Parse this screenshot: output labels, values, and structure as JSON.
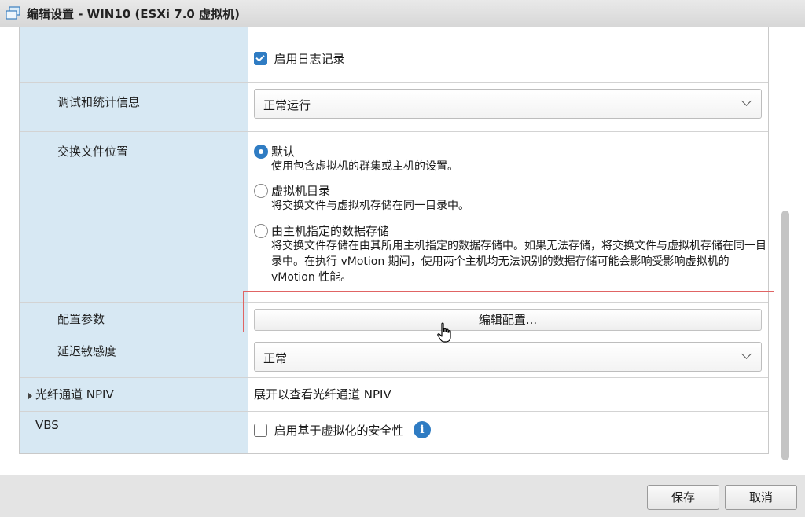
{
  "window": {
    "title": "编辑设置 - WIN10 (ESXi 7.0 虚拟机)"
  },
  "logging": {
    "checkbox_label": "启用日志记录",
    "checked": true
  },
  "debug_stats": {
    "label": "调试和统计信息",
    "value": "正常运行"
  },
  "swap_location": {
    "label": "交换文件位置",
    "options": [
      {
        "title": "默认",
        "desc": "使用包含虚拟机的群集或主机的设置。",
        "selected": true
      },
      {
        "title": "虚拟机目录",
        "desc": "将交换文件与虚拟机存储在同一目录中。",
        "selected": false
      },
      {
        "title": "由主机指定的数据存储",
        "desc": "将交换文件存储在由其所用主机指定的数据存储中。如果无法存储，将交换文件与虚拟机存储在同一目录中。在执行 vMotion 期间，使用两个主机均无法识别的数据存储可能会影响受影响虚拟机的 vMotion 性能。",
        "selected": false
      }
    ]
  },
  "config_params": {
    "label": "配置参数",
    "button_label": "编辑配置..."
  },
  "latency": {
    "label": "延迟敏感度",
    "value": "正常"
  },
  "npiv": {
    "label": "光纤通道 NPIV",
    "value": "展开以查看光纤通道 NPIV"
  },
  "vbs": {
    "label": "VBS",
    "checkbox_label": "启用基于虚拟化的安全性",
    "checked": false
  },
  "footer": {
    "save_label": "保存",
    "cancel_label": "取消"
  },
  "colors": {
    "accent": "#2f7cc3",
    "label_bg": "#d7e8f3",
    "highlight": "#e06464"
  }
}
